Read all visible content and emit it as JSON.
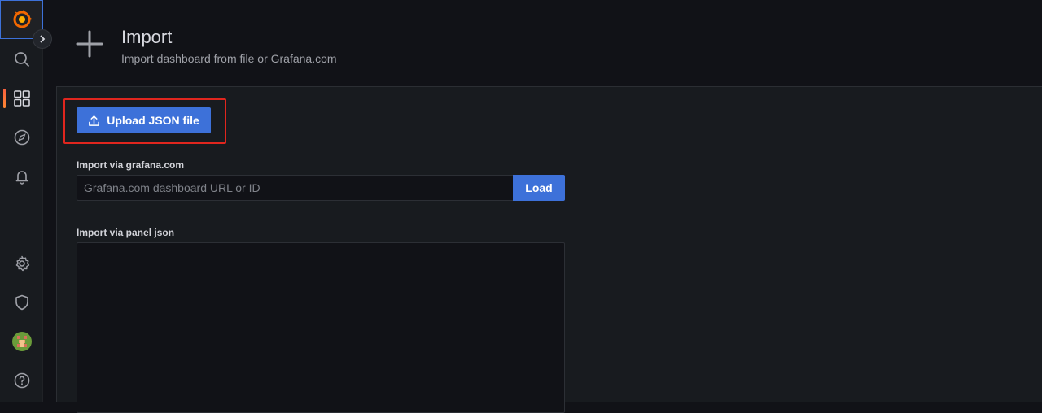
{
  "header": {
    "title": "Import",
    "subtitle": "Import dashboard from file or Grafana.com"
  },
  "sidebar": {
    "items": [
      {
        "icon": "grafana-logo-icon"
      },
      {
        "icon": "search-icon"
      },
      {
        "icon": "dashboards-icon",
        "active": true
      },
      {
        "icon": "explore-compass-icon"
      },
      {
        "icon": "alerting-bell-icon"
      },
      {
        "icon": "configuration-gear-icon"
      },
      {
        "icon": "server-admin-shield-icon"
      },
      {
        "icon": "user-avatar"
      },
      {
        "icon": "help-icon"
      }
    ]
  },
  "upload": {
    "label": "Upload JSON file"
  },
  "grafana_import": {
    "label": "Import via grafana.com",
    "placeholder": "Grafana.com dashboard URL or ID",
    "button": "Load"
  },
  "panel_json": {
    "label": "Import via panel json"
  },
  "colors": {
    "primary": "#3d71d9",
    "highlight": "#e0261e",
    "background": "#111217",
    "panel": "#181b1f"
  }
}
